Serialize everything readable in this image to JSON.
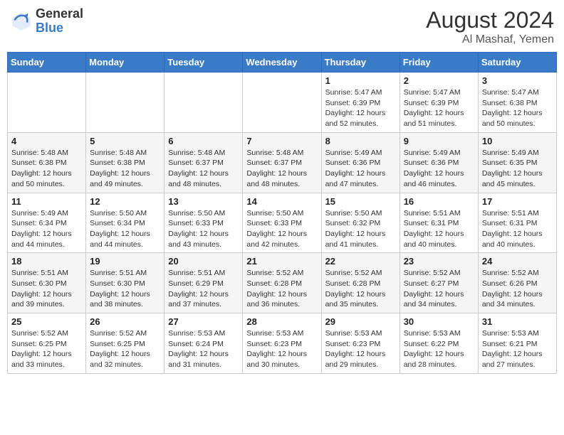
{
  "header": {
    "logo_general": "General",
    "logo_blue": "Blue",
    "title": "August 2024",
    "subtitle": "Al Mashaf, Yemen"
  },
  "days_of_week": [
    "Sunday",
    "Monday",
    "Tuesday",
    "Wednesday",
    "Thursday",
    "Friday",
    "Saturday"
  ],
  "weeks": [
    [
      {
        "day": "",
        "info": ""
      },
      {
        "day": "",
        "info": ""
      },
      {
        "day": "",
        "info": ""
      },
      {
        "day": "",
        "info": ""
      },
      {
        "day": "1",
        "info": "Sunrise: 5:47 AM\nSunset: 6:39 PM\nDaylight: 12 hours\nand 52 minutes."
      },
      {
        "day": "2",
        "info": "Sunrise: 5:47 AM\nSunset: 6:39 PM\nDaylight: 12 hours\nand 51 minutes."
      },
      {
        "day": "3",
        "info": "Sunrise: 5:47 AM\nSunset: 6:38 PM\nDaylight: 12 hours\nand 50 minutes."
      }
    ],
    [
      {
        "day": "4",
        "info": "Sunrise: 5:48 AM\nSunset: 6:38 PM\nDaylight: 12 hours\nand 50 minutes."
      },
      {
        "day": "5",
        "info": "Sunrise: 5:48 AM\nSunset: 6:38 PM\nDaylight: 12 hours\nand 49 minutes."
      },
      {
        "day": "6",
        "info": "Sunrise: 5:48 AM\nSunset: 6:37 PM\nDaylight: 12 hours\nand 48 minutes."
      },
      {
        "day": "7",
        "info": "Sunrise: 5:48 AM\nSunset: 6:37 PM\nDaylight: 12 hours\nand 48 minutes."
      },
      {
        "day": "8",
        "info": "Sunrise: 5:49 AM\nSunset: 6:36 PM\nDaylight: 12 hours\nand 47 minutes."
      },
      {
        "day": "9",
        "info": "Sunrise: 5:49 AM\nSunset: 6:36 PM\nDaylight: 12 hours\nand 46 minutes."
      },
      {
        "day": "10",
        "info": "Sunrise: 5:49 AM\nSunset: 6:35 PM\nDaylight: 12 hours\nand 45 minutes."
      }
    ],
    [
      {
        "day": "11",
        "info": "Sunrise: 5:49 AM\nSunset: 6:34 PM\nDaylight: 12 hours\nand 44 minutes."
      },
      {
        "day": "12",
        "info": "Sunrise: 5:50 AM\nSunset: 6:34 PM\nDaylight: 12 hours\nand 44 minutes."
      },
      {
        "day": "13",
        "info": "Sunrise: 5:50 AM\nSunset: 6:33 PM\nDaylight: 12 hours\nand 43 minutes."
      },
      {
        "day": "14",
        "info": "Sunrise: 5:50 AM\nSunset: 6:33 PM\nDaylight: 12 hours\nand 42 minutes."
      },
      {
        "day": "15",
        "info": "Sunrise: 5:50 AM\nSunset: 6:32 PM\nDaylight: 12 hours\nand 41 minutes."
      },
      {
        "day": "16",
        "info": "Sunrise: 5:51 AM\nSunset: 6:31 PM\nDaylight: 12 hours\nand 40 minutes."
      },
      {
        "day": "17",
        "info": "Sunrise: 5:51 AM\nSunset: 6:31 PM\nDaylight: 12 hours\nand 40 minutes."
      }
    ],
    [
      {
        "day": "18",
        "info": "Sunrise: 5:51 AM\nSunset: 6:30 PM\nDaylight: 12 hours\nand 39 minutes."
      },
      {
        "day": "19",
        "info": "Sunrise: 5:51 AM\nSunset: 6:30 PM\nDaylight: 12 hours\nand 38 minutes."
      },
      {
        "day": "20",
        "info": "Sunrise: 5:51 AM\nSunset: 6:29 PM\nDaylight: 12 hours\nand 37 minutes."
      },
      {
        "day": "21",
        "info": "Sunrise: 5:52 AM\nSunset: 6:28 PM\nDaylight: 12 hours\nand 36 minutes."
      },
      {
        "day": "22",
        "info": "Sunrise: 5:52 AM\nSunset: 6:28 PM\nDaylight: 12 hours\nand 35 minutes."
      },
      {
        "day": "23",
        "info": "Sunrise: 5:52 AM\nSunset: 6:27 PM\nDaylight: 12 hours\nand 34 minutes."
      },
      {
        "day": "24",
        "info": "Sunrise: 5:52 AM\nSunset: 6:26 PM\nDaylight: 12 hours\nand 34 minutes."
      }
    ],
    [
      {
        "day": "25",
        "info": "Sunrise: 5:52 AM\nSunset: 6:25 PM\nDaylight: 12 hours\nand 33 minutes."
      },
      {
        "day": "26",
        "info": "Sunrise: 5:52 AM\nSunset: 6:25 PM\nDaylight: 12 hours\nand 32 minutes."
      },
      {
        "day": "27",
        "info": "Sunrise: 5:53 AM\nSunset: 6:24 PM\nDaylight: 12 hours\nand 31 minutes."
      },
      {
        "day": "28",
        "info": "Sunrise: 5:53 AM\nSunset: 6:23 PM\nDaylight: 12 hours\nand 30 minutes."
      },
      {
        "day": "29",
        "info": "Sunrise: 5:53 AM\nSunset: 6:23 PM\nDaylight: 12 hours\nand 29 minutes."
      },
      {
        "day": "30",
        "info": "Sunrise: 5:53 AM\nSunset: 6:22 PM\nDaylight: 12 hours\nand 28 minutes."
      },
      {
        "day": "31",
        "info": "Sunrise: 5:53 AM\nSunset: 6:21 PM\nDaylight: 12 hours\nand 27 minutes."
      }
    ]
  ]
}
